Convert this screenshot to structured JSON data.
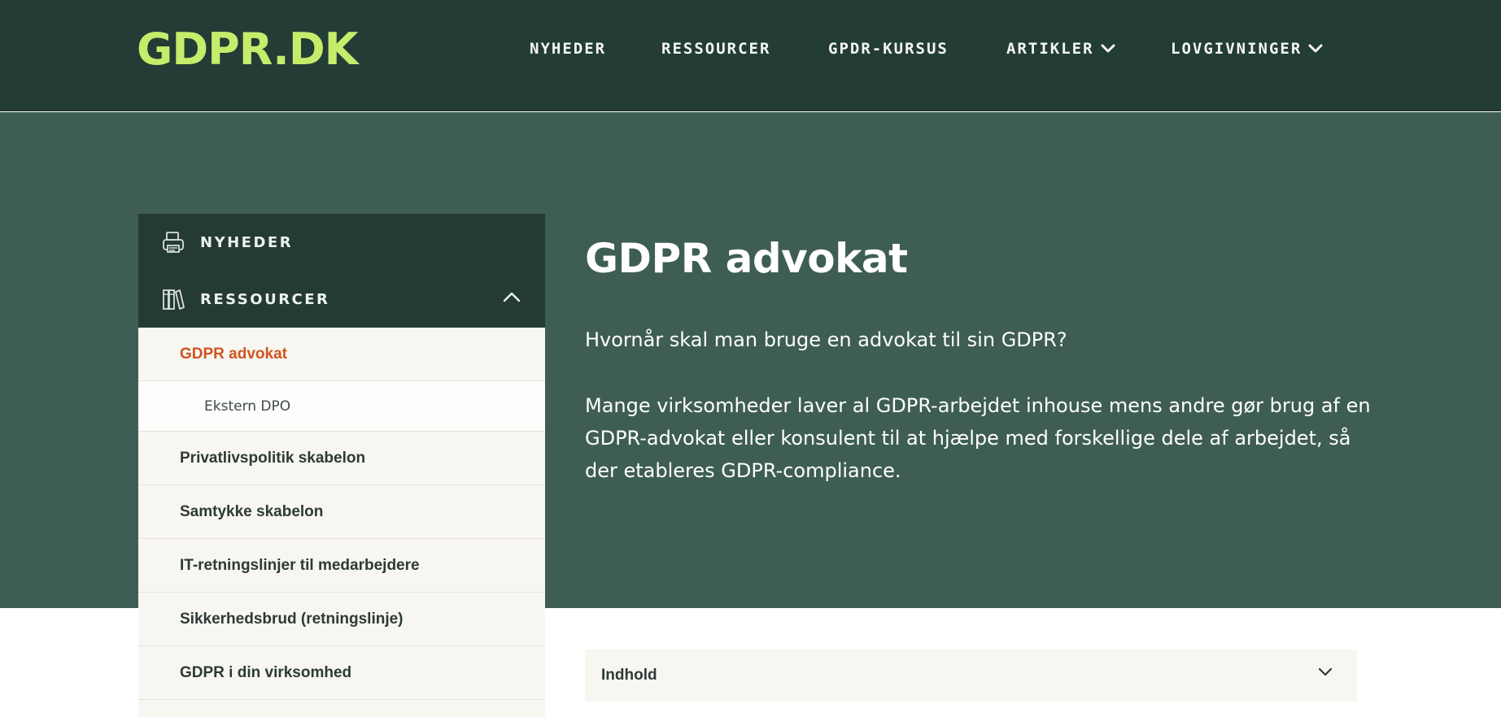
{
  "header": {
    "logo": "GDPR.DK",
    "nav": [
      {
        "label": "NYHEDER",
        "dropdown": false
      },
      {
        "label": "RESSOURCER",
        "dropdown": false
      },
      {
        "label": "GPDR-KURSUS",
        "dropdown": false
      },
      {
        "label": "ARTIKLER",
        "dropdown": true
      },
      {
        "label": "LOVGIVNINGER",
        "dropdown": true
      }
    ]
  },
  "sidebar": {
    "nyheder": {
      "label": "NYHEDER",
      "icon": "printer-icon"
    },
    "ressourcer": {
      "label": "RESSOURCER",
      "icon": "books-icon",
      "expanded": true
    },
    "items": [
      {
        "label": "GDPR advokat",
        "active": true
      },
      {
        "label": "Ekstern DPO",
        "sub": true
      },
      {
        "label": "Privatlivspolitik skabelon"
      },
      {
        "label": "Samtykke skabelon"
      },
      {
        "label": "IT-retningslinjer til medarbejdere"
      },
      {
        "label": "Sikkerhedsbrud (retningslinje)"
      },
      {
        "label": "GDPR i din virksomhed"
      }
    ]
  },
  "main": {
    "title": "GDPR advokat",
    "intro": "Hvornår skal man bruge en advokat til sin GDPR?",
    "body_line1": "Mange virksomheder laver al GDPR-arbejdet inhouse mens andre gør brug af en",
    "body_line2": "GDPR-advokat eller konsulent til at hjælpe med forskellige dele af arbejdet, så",
    "body_line3": "der etableres GDPR-compliance.",
    "toc_label": "Indhold"
  },
  "colors": {
    "header_bg": "#243c36",
    "hero_bg": "#3e5d55",
    "logo": "#c5ec6a",
    "active_link": "#d0541f",
    "panel_bg": "#f7f6f1"
  }
}
